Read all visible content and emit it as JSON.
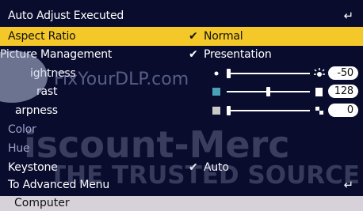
{
  "menu": {
    "title": "Auto Adjust Executed",
    "aspect_ratio": {
      "label": "Aspect Ratio",
      "value": "Normal"
    },
    "picture_management": {
      "label": "Picture Management",
      "value": "Presentation"
    },
    "brightness": {
      "label": "ightness",
      "value": "-50",
      "level": 0.0
    },
    "contrast": {
      "label": "rast",
      "value": "128",
      "level": 0.5
    },
    "sharpness": {
      "label": "arpness",
      "value": "0",
      "level": 0.0
    },
    "color": {
      "label": "Color"
    },
    "hue": {
      "label": "Hue"
    },
    "keystone": {
      "label": "Keystone",
      "value": "Auto"
    },
    "to_advanced_menu": {
      "label": "To Advanced Menu"
    }
  },
  "footer": {
    "source": "Computer"
  },
  "watermark": {
    "site": "FixYourDLP.com",
    "brand": "iscount-Merc",
    "tagline": "THE TRUSTED SOURCE F"
  },
  "colors": {
    "background": "#0a0c2e",
    "highlight": "#f5c82a",
    "footer": "#d7d2da",
    "dim_text": "#9aa1c6"
  }
}
